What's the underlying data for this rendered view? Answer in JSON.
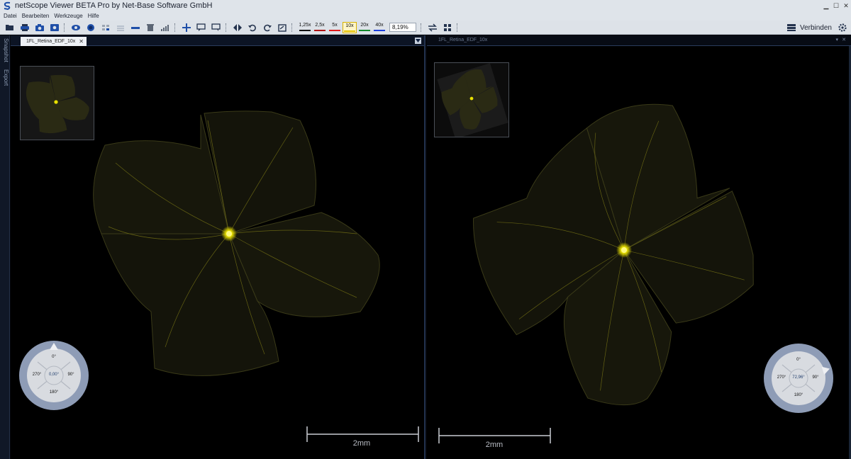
{
  "window": {
    "title": "netScope Viewer BETA Pro by Net-Base Software GmbH"
  },
  "menu": [
    "Datei",
    "Bearbeiten",
    "Werkzeuge",
    "Hilfe"
  ],
  "toolbar": {
    "zoom_levels": [
      {
        "label": "1,25x",
        "color": "#111111",
        "active": false
      },
      {
        "label": "2,5x",
        "color": "#b11414",
        "active": false
      },
      {
        "label": "5x",
        "color": "#e21b1b",
        "active": false
      },
      {
        "label": "10x",
        "color": "#e5c400",
        "active": true
      },
      {
        "label": "20x",
        "color": "#138a2b",
        "active": false
      },
      {
        "label": "40x",
        "color": "#1b3fe0",
        "active": false
      }
    ],
    "zoom_value": "8,19%",
    "connect_label": "Verbinden"
  },
  "dock_tabs": [
    "Snapshot",
    "Export"
  ],
  "left_view": {
    "tab_label": "1FL_Retina_EDF_10x",
    "scale_label": "2mm",
    "compass": {
      "top": "0°",
      "left": "270°",
      "right": "90°",
      "bottom": "180°",
      "center": "0,00°",
      "rotation_deg": 0
    }
  },
  "right_view": {
    "tab_label": "1FL_Retina_EDF_10x",
    "scale_label": "2mm",
    "compass": {
      "top": "0°",
      "left": "270°",
      "right": "90°",
      "bottom": "180°",
      "center": "72,96°",
      "rotation_deg": 72.96
    }
  },
  "colors": {
    "fluorescence": "#e8e000",
    "tissue": "#1c1c10",
    "accent": "#d6b000"
  }
}
